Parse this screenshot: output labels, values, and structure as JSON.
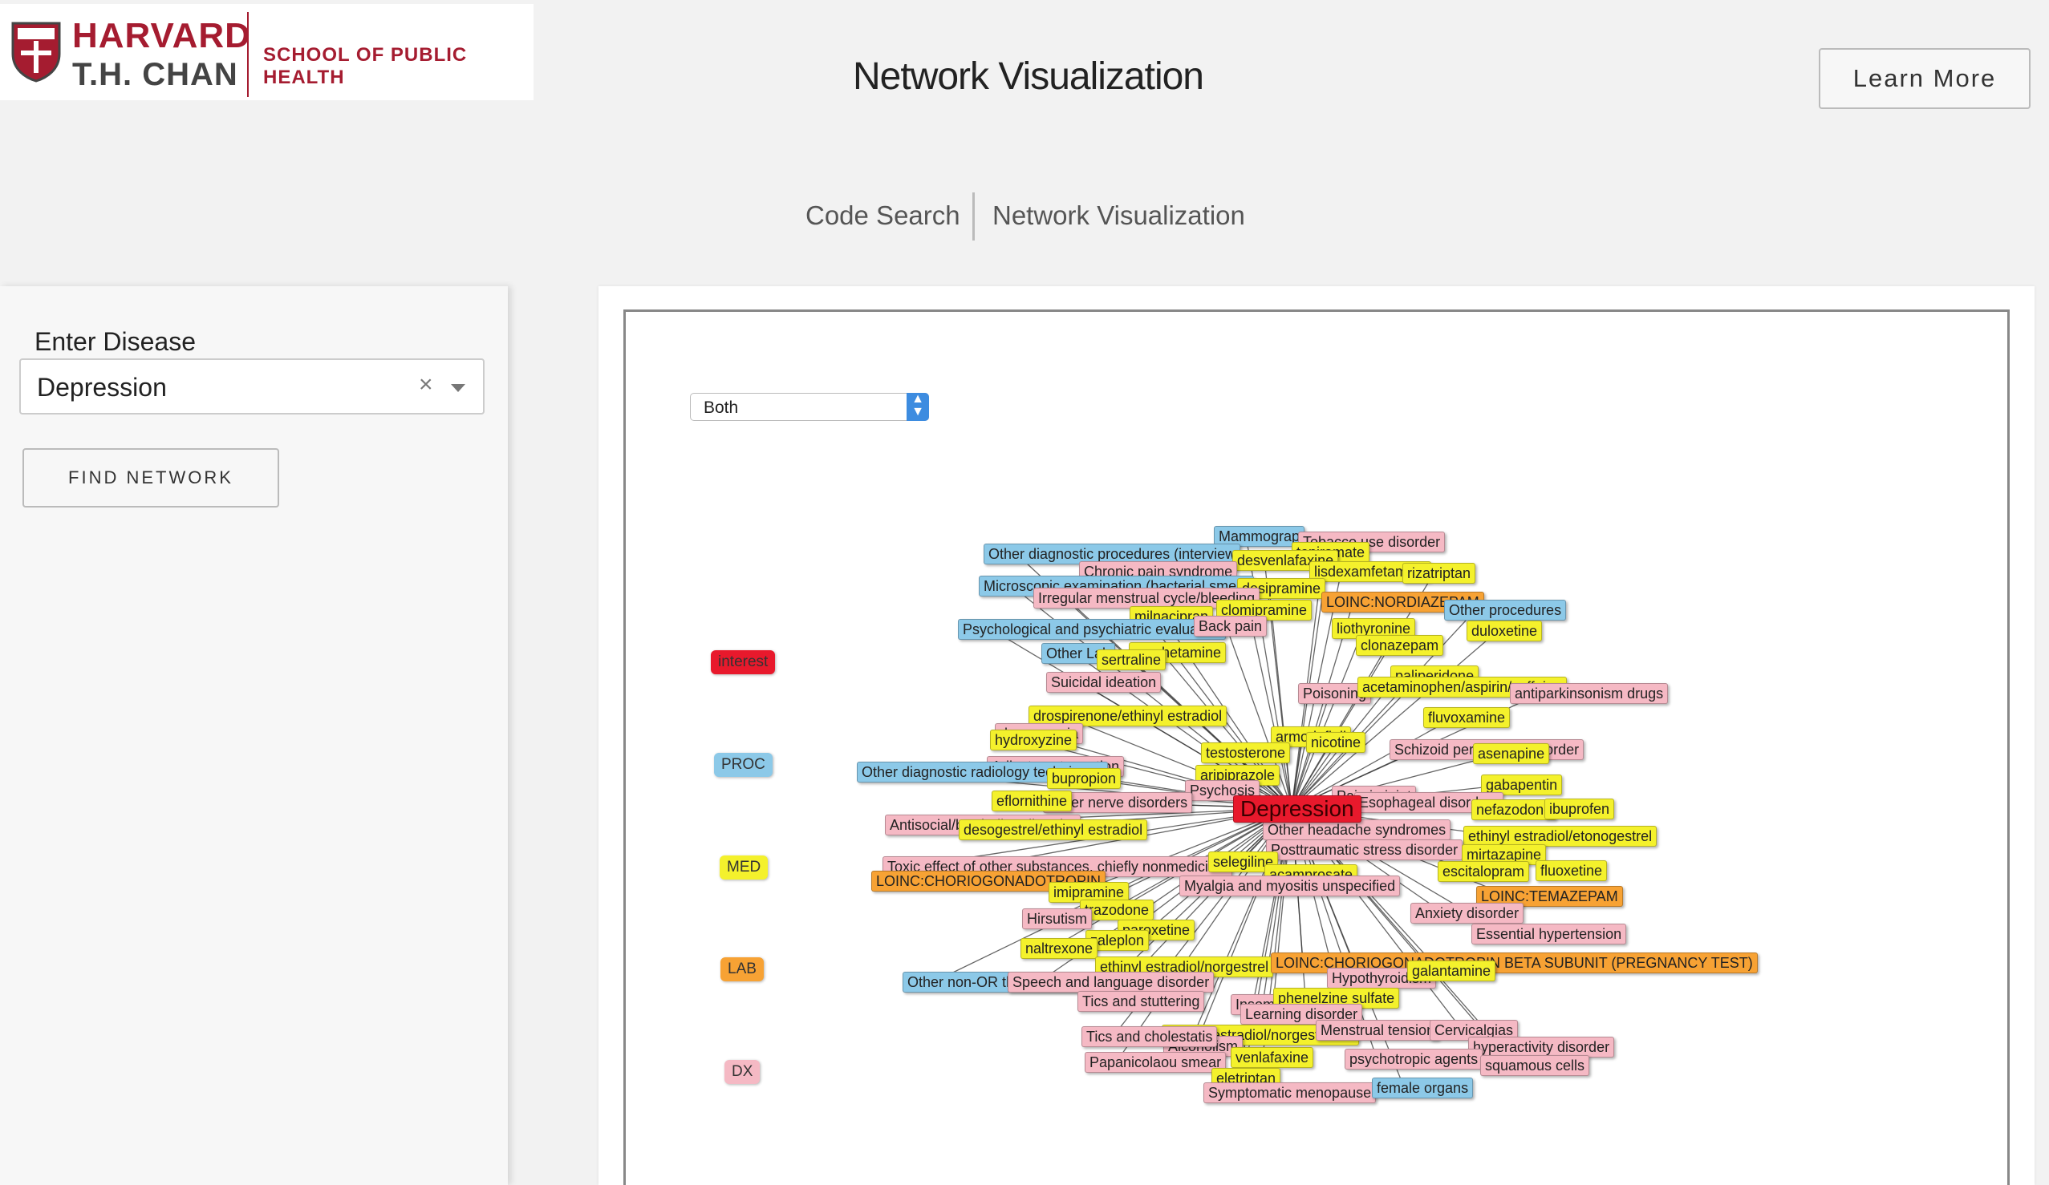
{
  "header": {
    "logo": {
      "line1": "HARVARD",
      "line2": "T.H. CHAN",
      "school": "SCHOOL OF PUBLIC HEALTH"
    },
    "title": "Network Visualization",
    "learn_more": "Learn More"
  },
  "nav": {
    "items": [
      {
        "label": "Code Search"
      },
      {
        "label": "Network Visualization"
      }
    ]
  },
  "sidebar": {
    "disease_label": "Enter Disease",
    "disease_value": "Depression",
    "clear_glyph": "×",
    "find_button": "FIND NETWORK"
  },
  "viz": {
    "type_select_value": "Both",
    "legend": [
      {
        "label": "interest",
        "color": "#e8192c"
      },
      {
        "label": "PROC",
        "color": "#8cc9e8"
      },
      {
        "label": "MED",
        "color": "#f4f12c"
      },
      {
        "label": "LAB",
        "color": "#f7a234"
      },
      {
        "label": "DX",
        "color": "#f5b9c4"
      }
    ],
    "center_node": "Depression",
    "nodes": [
      {
        "label": "Mammograp",
        "type": "proc"
      },
      {
        "label": "Tobacco use disorder",
        "type": "dx"
      },
      {
        "label": "Other diagnostic procedures (interview",
        "type": "proc"
      },
      {
        "label": "topiramate",
        "type": "med"
      },
      {
        "label": "desvenlafaxine",
        "type": "med"
      },
      {
        "label": "Chronic pain syndrome",
        "type": "dx"
      },
      {
        "label": "lisdexamfetamine",
        "type": "med"
      },
      {
        "label": "rizatriptan",
        "type": "med"
      },
      {
        "label": "Microscopic examination (bacterial smear",
        "type": "proc"
      },
      {
        "label": "desipramine",
        "type": "med"
      },
      {
        "label": "Irregular menstrual cycle/bleeding",
        "type": "dx"
      },
      {
        "label": "LOINC:NORDIAZEPAM",
        "type": "lab"
      },
      {
        "label": "clomipramine",
        "type": "med"
      },
      {
        "label": "milnacipran",
        "type": "med"
      },
      {
        "label": "Other procedures",
        "type": "proc"
      },
      {
        "label": "Psychological and psychiatric evaluation",
        "type": "proc"
      },
      {
        "label": "Back pain",
        "type": "dx"
      },
      {
        "label": "liothyronine",
        "type": "med"
      },
      {
        "label": "duloxetine",
        "type": "med"
      },
      {
        "label": "clonazepam",
        "type": "med"
      },
      {
        "label": "amphetamine",
        "type": "med"
      },
      {
        "label": "Other Lab",
        "type": "proc"
      },
      {
        "label": "sertraline",
        "type": "med"
      },
      {
        "label": "paliperidone",
        "type": "med"
      },
      {
        "label": "Suicidal ideation",
        "type": "dx"
      },
      {
        "label": "Poisoning",
        "type": "dx"
      },
      {
        "label": "acetaminophen/aspirin/caffeine",
        "type": "med"
      },
      {
        "label": "antiparkinsonism drugs",
        "type": "dx"
      },
      {
        "label": "drospirenone/ethinyl estradiol",
        "type": "med"
      },
      {
        "label": "fluvoxamine",
        "type": "med"
      },
      {
        "label": "dyspareunia",
        "type": "dx"
      },
      {
        "label": "hydroxyzine",
        "type": "med"
      },
      {
        "label": "armodafinil",
        "type": "med"
      },
      {
        "label": "nicotine",
        "type": "med"
      },
      {
        "label": "testosterone",
        "type": "med"
      },
      {
        "label": "Schizoid personality disorder",
        "type": "dx"
      },
      {
        "label": "asenapine",
        "type": "med"
      },
      {
        "label": "Adjustment reaction",
        "type": "dx"
      },
      {
        "label": "Other diagnostic radiology techniques",
        "type": "proc"
      },
      {
        "label": "aripiprazole",
        "type": "med"
      },
      {
        "label": "bupropion",
        "type": "med"
      },
      {
        "label": "gabapentin",
        "type": "med"
      },
      {
        "label": "Psychosis",
        "type": "dx"
      },
      {
        "label": "Pain in joint",
        "type": "dx"
      },
      {
        "label": "Esophageal disorders",
        "type": "dx"
      },
      {
        "label": "nefazodone",
        "type": "med"
      },
      {
        "label": "ibuprofen",
        "type": "med"
      },
      {
        "label": "Other nerve disorders",
        "type": "dx"
      },
      {
        "label": "eflornithine",
        "type": "med"
      },
      {
        "label": "Antisocial/borderline disorder",
        "type": "dx"
      },
      {
        "label": "desogestrel/ethinyl estradiol",
        "type": "med"
      },
      {
        "label": "Other headache syndromes",
        "type": "dx"
      },
      {
        "label": "ethinyl estradiol/etonogestrel",
        "type": "med"
      },
      {
        "label": "Posttraumatic stress disorder",
        "type": "dx"
      },
      {
        "label": "mirtazapine",
        "type": "med"
      },
      {
        "label": "Toxic effect of other substances, chiefly nonmedicinal",
        "type": "dx"
      },
      {
        "label": "selegiline",
        "type": "med"
      },
      {
        "label": "escitalopram",
        "type": "med"
      },
      {
        "label": "fluoxetine",
        "type": "med"
      },
      {
        "label": "LOINC:CHORIOGONADOTROPIN",
        "type": "lab"
      },
      {
        "label": "acamprosate",
        "type": "med"
      },
      {
        "label": "Myalgia and myositis unspecified",
        "type": "dx"
      },
      {
        "label": "LOINC:TEMAZEPAM",
        "type": "lab"
      },
      {
        "label": "imipramine",
        "type": "med"
      },
      {
        "label": "trazodone",
        "type": "med"
      },
      {
        "label": "Anxiety disorder",
        "type": "dx"
      },
      {
        "label": "Hirsutism",
        "type": "dx"
      },
      {
        "label": "paroxetine",
        "type": "med"
      },
      {
        "label": "Essential hypertension",
        "type": "dx"
      },
      {
        "label": "zaleplon",
        "type": "med"
      },
      {
        "label": "naltrexone",
        "type": "med"
      },
      {
        "label": "ethinyl estradiol/norgestrel",
        "type": "med"
      },
      {
        "label": "LOINC:CHORIOGONADOTROPIN BETA SUBUNIT (PREGNANCY TEST)",
        "type": "lab"
      },
      {
        "label": "Other non-OR therapeutic procedures",
        "type": "proc"
      },
      {
        "label": "Speech and language disorder",
        "type": "dx"
      },
      {
        "label": "Hypothyroidism",
        "type": "dx"
      },
      {
        "label": "galantamine",
        "type": "med"
      },
      {
        "label": "Tics and stuttering",
        "type": "dx"
      },
      {
        "label": "Insomnia",
        "type": "dx"
      },
      {
        "label": "phenelzine sulfate",
        "type": "med"
      },
      {
        "label": "Learning disorder",
        "type": "dx"
      },
      {
        "label": "ethinyl estradiol/norgestimate",
        "type": "med"
      },
      {
        "label": "Menstrual tension",
        "type": "dx"
      },
      {
        "label": "Cervicalgias",
        "type": "dx"
      },
      {
        "label": "Alcoholism",
        "type": "dx"
      },
      {
        "label": "hyperactivity disorder",
        "type": "dx"
      },
      {
        "label": "Papanicolaou smear",
        "type": "dx"
      },
      {
        "label": "venlafaxine",
        "type": "med"
      },
      {
        "label": "psychotropic agents",
        "type": "dx"
      },
      {
        "label": "squamous cells",
        "type": "dx"
      },
      {
        "label": "eletriptan",
        "type": "med"
      },
      {
        "label": "Symptomatic menopause",
        "type": "dx"
      },
      {
        "label": "female organs",
        "type": "proc"
      },
      {
        "label": "Tics and cholestatis",
        "type": "dx"
      }
    ]
  }
}
